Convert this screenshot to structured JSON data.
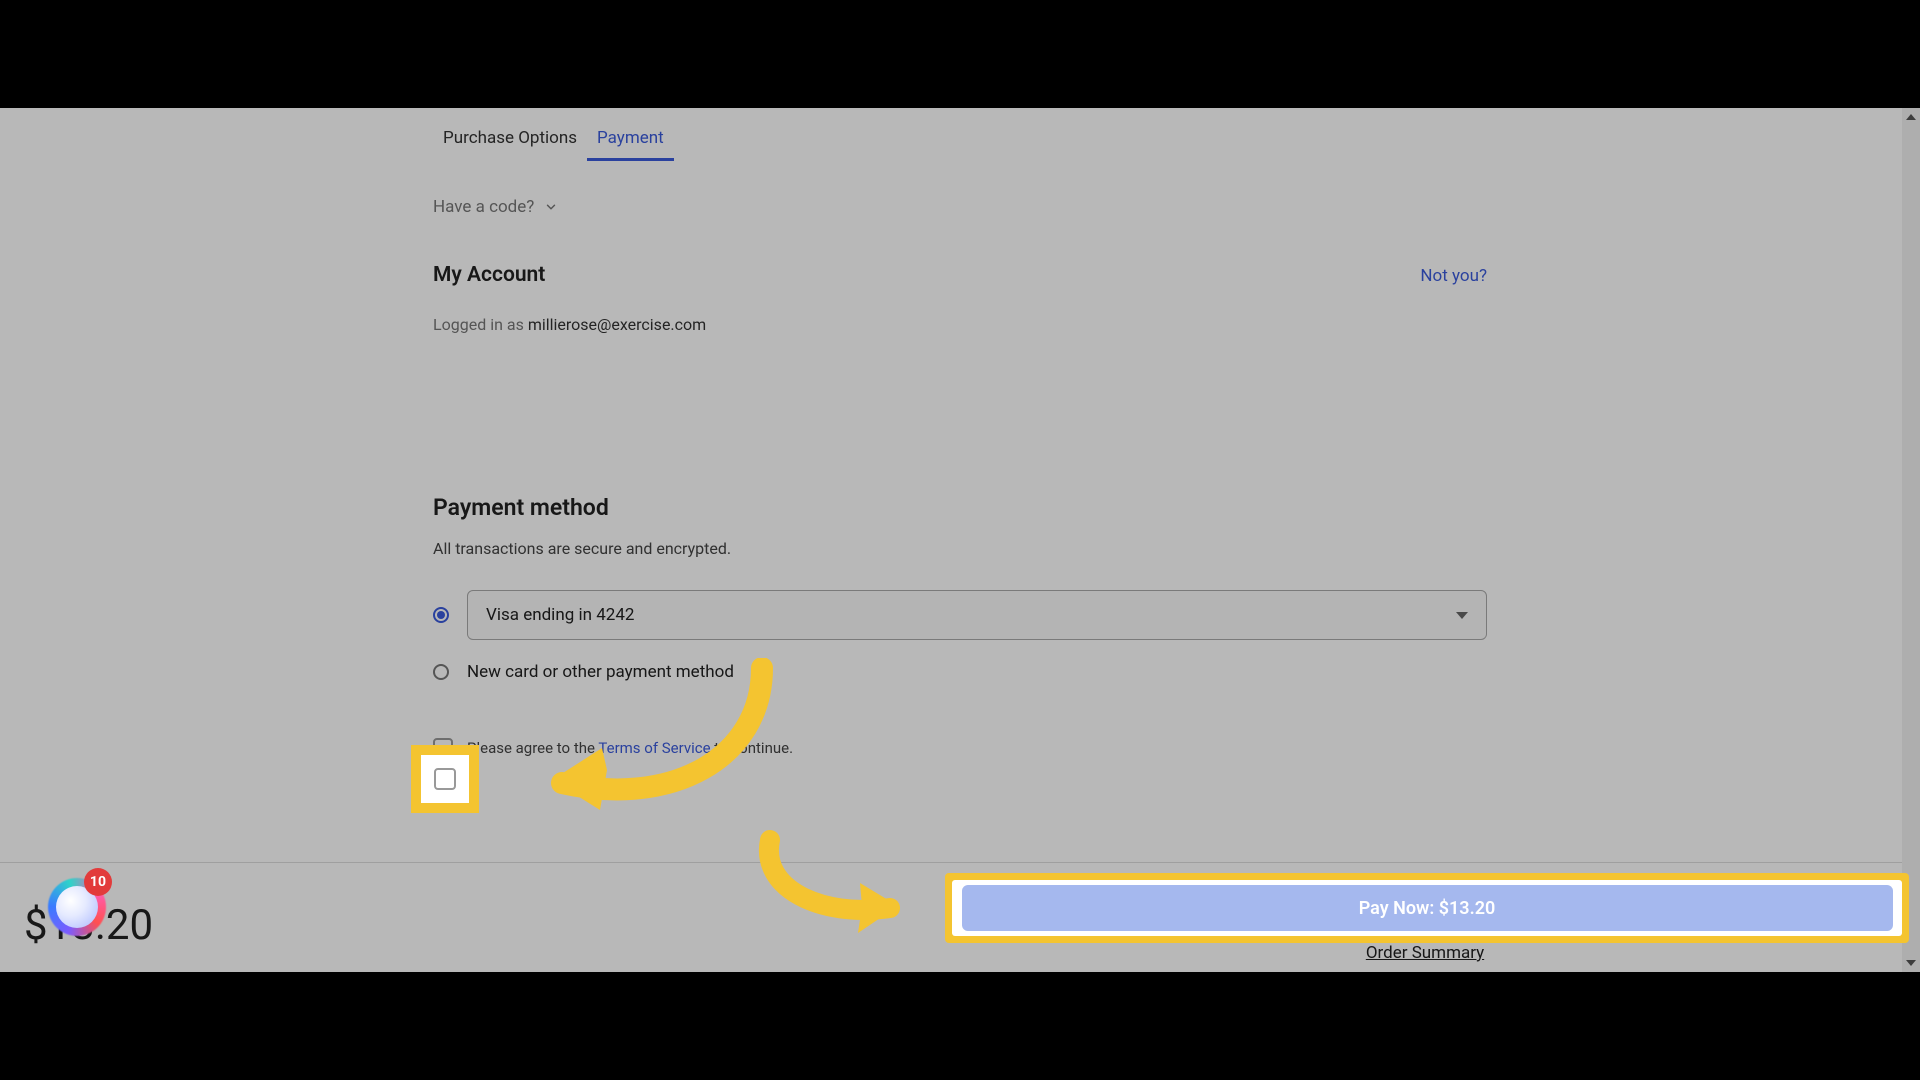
{
  "tabs": {
    "purchase_options": "Purchase Options",
    "payment": "Payment"
  },
  "have_code": "Have a code?",
  "account": {
    "title": "My Account",
    "not_you": "Not you?",
    "logged_in_prefix": "Logged in as ",
    "email": "millierose@exercise.com"
  },
  "payment_method": {
    "title": "Payment method",
    "note": "All transactions are secure and encrypted.",
    "saved_card_label": "Visa ending in 4242",
    "new_card_label": "New card or other payment method"
  },
  "tos": {
    "prefix": "Please agree to the ",
    "link": "Terms of Service",
    "suffix": " to continue."
  },
  "footer": {
    "total": "$13.20",
    "pay_button": "Pay Now: $13.20",
    "order_summary": "Order Summary"
  },
  "widget": {
    "badge": "10"
  },
  "colors": {
    "accent": "#3b5bdb",
    "highlight": "#f4c430",
    "pay_btn_bg": "#a5b8ee"
  }
}
